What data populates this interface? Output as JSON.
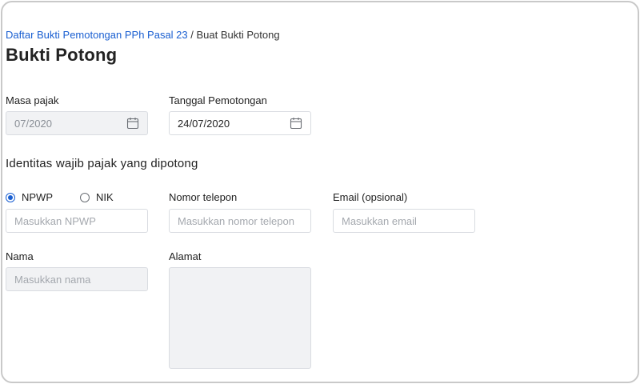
{
  "breadcrumb": {
    "parent": "Daftar Bukti Pemotongan PPh Pasal 23",
    "separator": " / ",
    "current": "Buat Bukti Potong"
  },
  "page_title": "Bukti Potong",
  "masa_pajak": {
    "label": "Masa pajak",
    "value": "07/2020"
  },
  "tanggal_pemotongan": {
    "label": "Tanggal Pemotongan",
    "value": "24/07/2020"
  },
  "section_identity": "Identitas wajib pajak yang dipotong",
  "id_type": {
    "options": [
      {
        "label": "NPWP",
        "selected": true
      },
      {
        "label": "NIK",
        "selected": false
      }
    ]
  },
  "npwp": {
    "placeholder": "Masukkan NPWP"
  },
  "nomor_telepon": {
    "label": "Nomor telepon",
    "placeholder": "Masukkan nomor telepon"
  },
  "email": {
    "label": "Email (opsional)",
    "placeholder": "Masukkan email"
  },
  "nama": {
    "label": "Nama",
    "placeholder": "Masukkan nama"
  },
  "alamat": {
    "label": "Alamat",
    "value": ""
  },
  "icons": {
    "calendar": "calendar-icon"
  },
  "colors": {
    "link": "#1a5fd1",
    "disabled_bg": "#f1f2f4",
    "border": "#d9dce1"
  }
}
